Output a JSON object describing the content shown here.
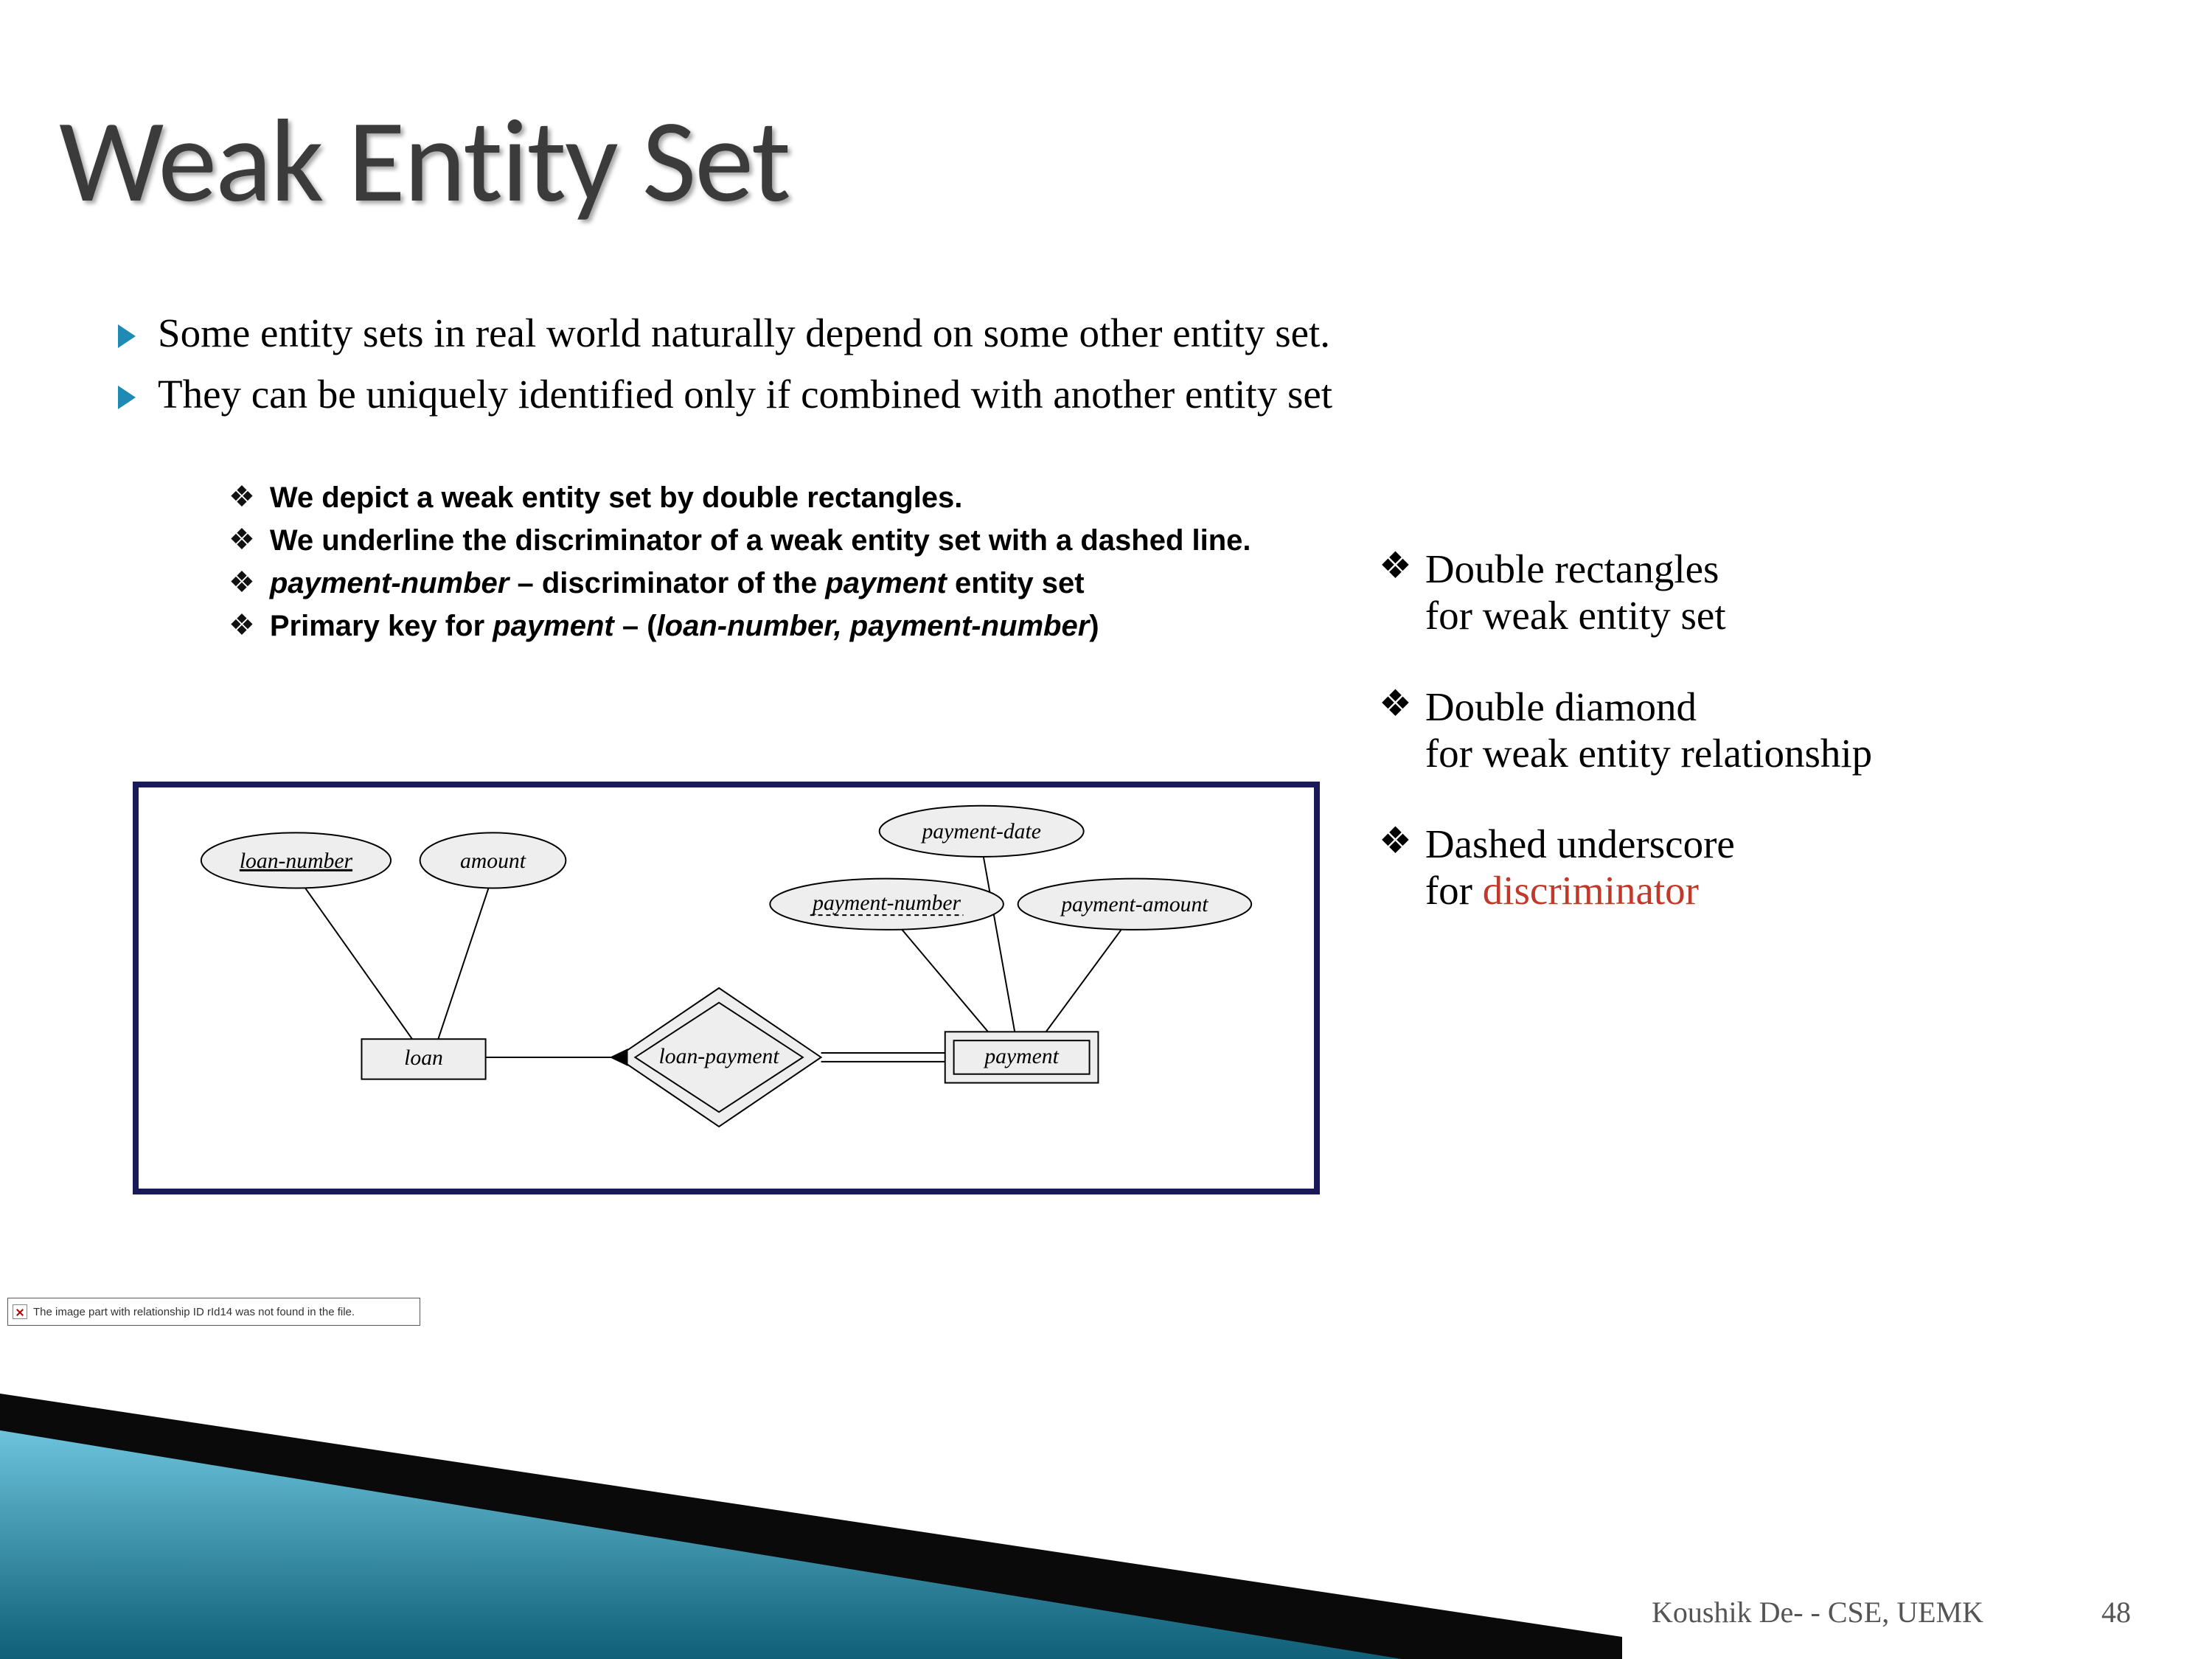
{
  "title": "Weak Entity Set",
  "bullets": [
    "Some entity sets in real world naturally depend on some other entity set.",
    "They can be uniquely identified only if combined with another entity set"
  ],
  "inner": {
    "b1": "We depict a weak entity set by double rectangles.",
    "b2": "We underline the discriminator of a weak entity set  with a dashed line.",
    "b3_pre": "payment-number",
    "b3_mid": " – discriminator of the ",
    "b3_ital": "payment",
    "b3_post": " entity set",
    "b4_pre": "Primary key for ",
    "b4_ital1": "payment",
    "b4_mid": " – (",
    "b4_ital2": "loan-number, payment-number",
    "b4_post": ")"
  },
  "right": {
    "r1_lead": "Double rectangles",
    "r1_rest": "for weak entity set",
    "r2_lead": "Double diamond",
    "r2_rest": "for weak entity relationship",
    "r3_lead": "Dashed underscore",
    "r3_rest_pre": "for ",
    "r3_red": "discriminator"
  },
  "diagram": {
    "loan_number": "loan-number",
    "amount": "amount",
    "payment_date": "payment-date",
    "payment_number": "payment-number",
    "payment_amount": "payment-amount",
    "loan": "loan",
    "loan_payment": "loan-payment",
    "payment": "payment"
  },
  "error_text": "The image part with relationship ID rId14 was not found in the file.",
  "footer_author": "Koushik De- - CSE, UEMK",
  "footer_page": "48"
}
